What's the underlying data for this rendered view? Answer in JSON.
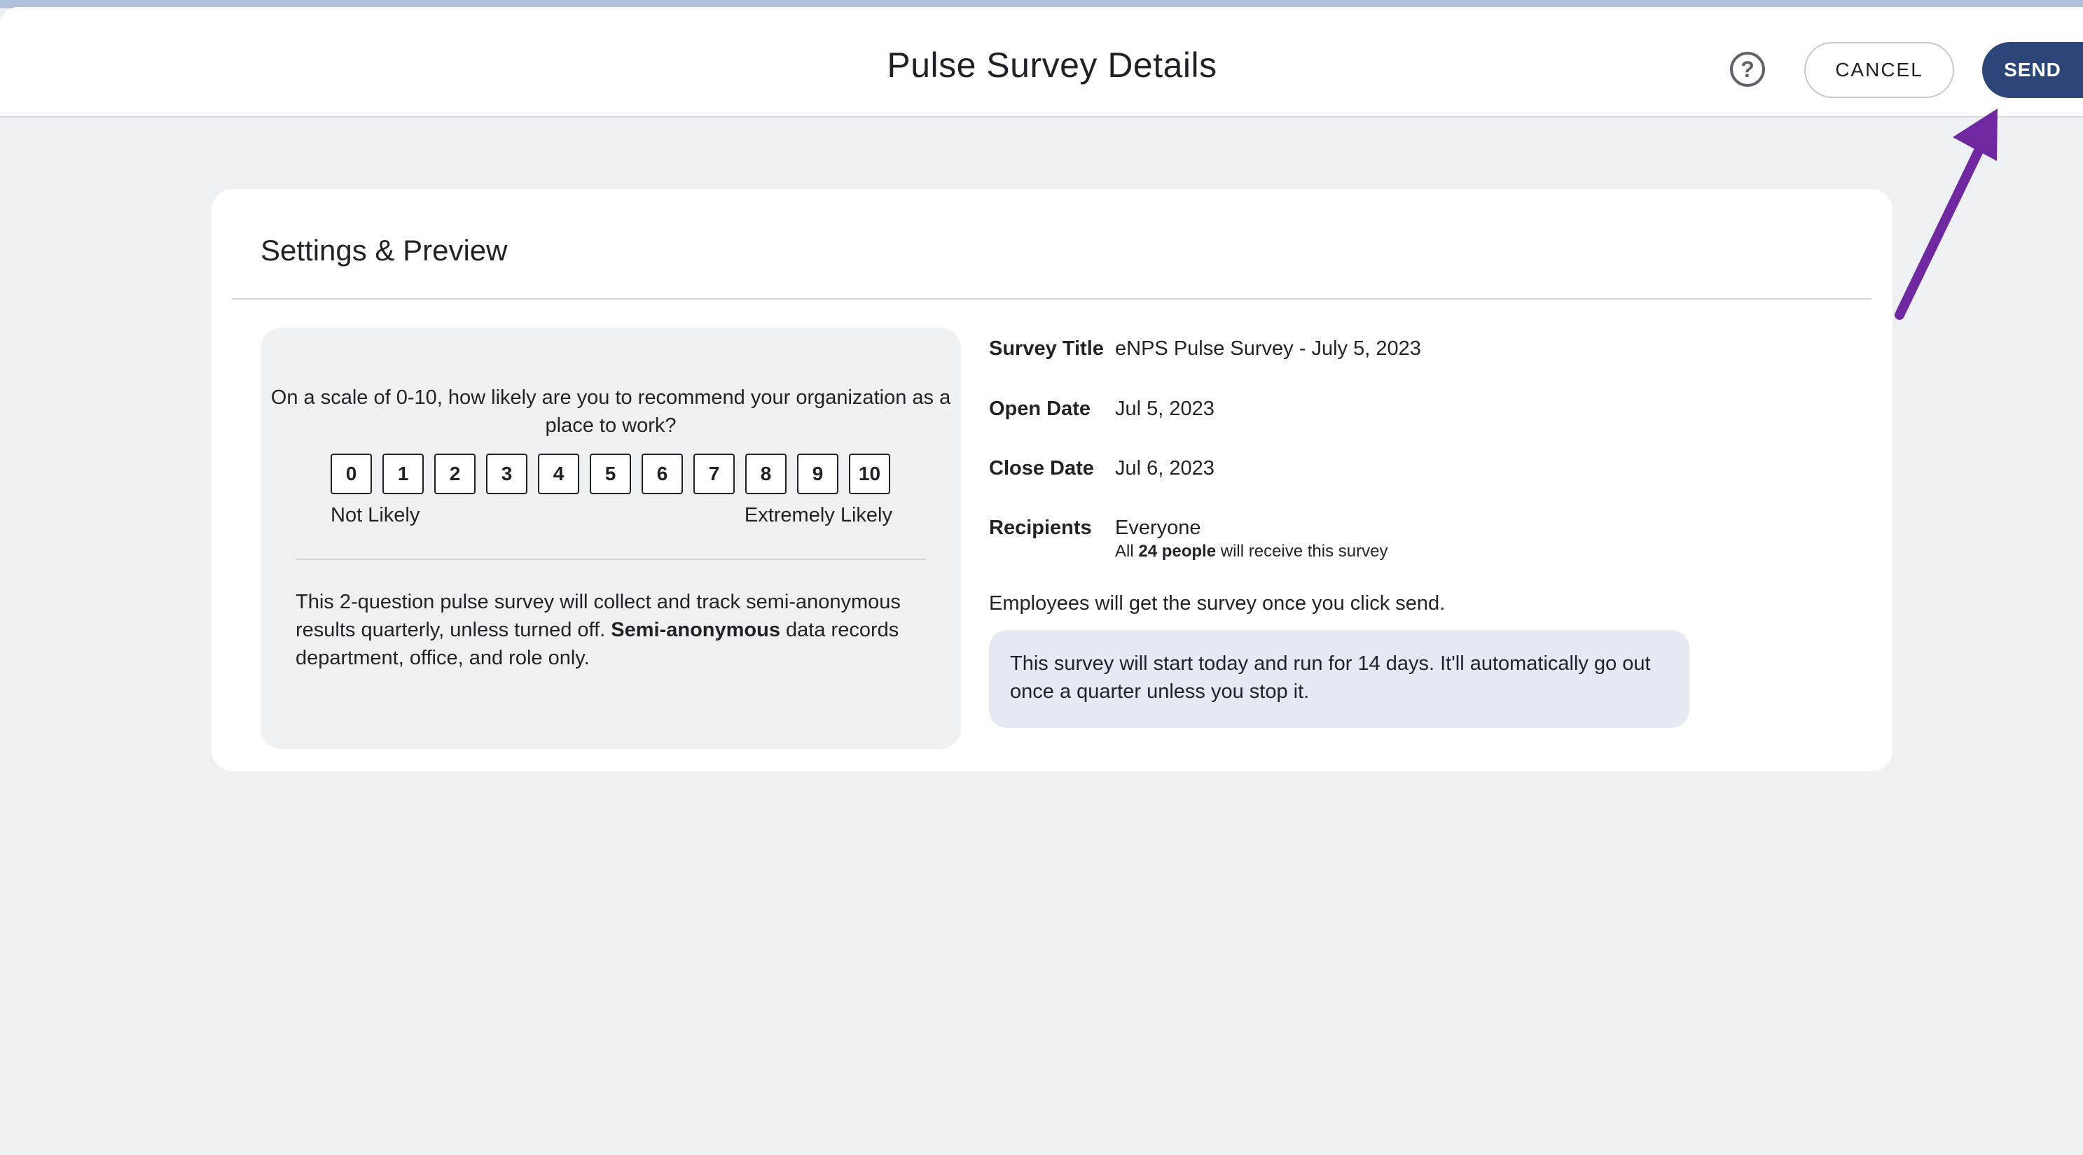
{
  "header": {
    "title": "Pulse Survey Details",
    "help_icon": "question-circle-icon",
    "help_glyph": "?",
    "cancel_label": "CANCEL",
    "send_label": "SEND"
  },
  "card": {
    "title": "Settings & Preview",
    "preview": {
      "question": "On a scale of 0-10, how likely are you to recommend your organization as a place to work?",
      "scale": [
        "0",
        "1",
        "2",
        "3",
        "4",
        "5",
        "6",
        "7",
        "8",
        "9",
        "10"
      ],
      "low_label": "Not Likely",
      "high_label": "Extremely Likely",
      "desc_pre": "This 2-question pulse survey will collect and track semi-anonymous results quarterly, unless turned off. ",
      "desc_bold": "Semi-anonymous",
      "desc_post": " data records department, office, and role only."
    },
    "details": {
      "survey_title_label": "Survey Title",
      "survey_title_value": "eNPS Pulse Survey - July 5, 2023",
      "open_date_label": "Open Date",
      "open_date_value": "Jul 5, 2023",
      "close_date_label": "Close Date",
      "close_date_value": "Jul 6, 2023",
      "recipients_label": "Recipients",
      "recipients_value": "Everyone",
      "recipients_sub_pre": "All ",
      "recipients_sub_bold": "24 people",
      "recipients_sub_post": " will receive this survey",
      "send_note": "Employees will get the survey once you click send.",
      "info": "This survey will start today and run for 14 days. It'll automatically go out once a quarter unless you stop it."
    }
  },
  "colors": {
    "send_button": "#2c4679",
    "annotation_arrow": "#7028a0",
    "page_background": "#eef1f4"
  }
}
